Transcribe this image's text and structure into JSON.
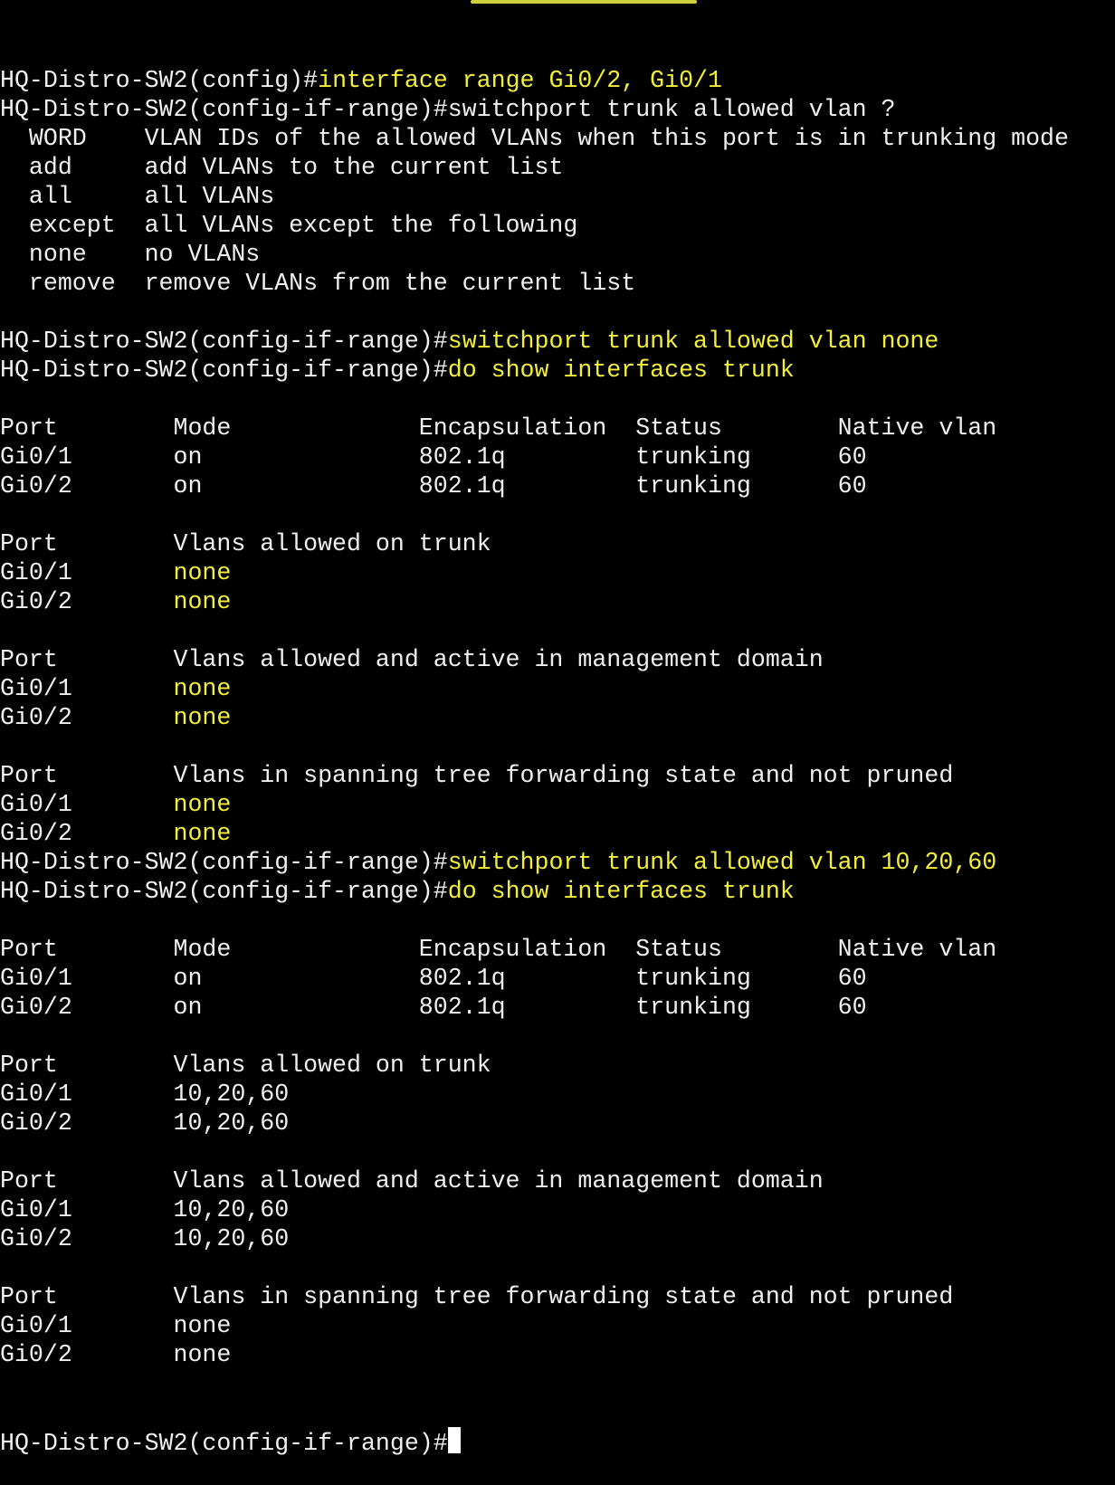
{
  "window": {
    "colors": {
      "background": "#000000",
      "text": "#f0f0f0",
      "highlight": "#f2ee3a"
    }
  },
  "terminal": {
    "lines": [
      [
        {
          "t": "HQ-Distro-SW2(config)#",
          "c": "w"
        },
        {
          "t": "interface range Gi0/2, Gi0/1",
          "c": "y"
        }
      ],
      [
        {
          "t": "HQ-Distro-SW2(config-if-range)#switchport trunk allowed vlan ?",
          "c": "w"
        }
      ],
      [
        {
          "t": "  WORD    VLAN IDs of the allowed VLANs when this port is in trunking mode",
          "c": "w"
        }
      ],
      [
        {
          "t": "  add     add VLANs to the current list",
          "c": "w"
        }
      ],
      [
        {
          "t": "  all     all VLANs",
          "c": "w"
        }
      ],
      [
        {
          "t": "  except  all VLANs except the following",
          "c": "w"
        }
      ],
      [
        {
          "t": "  none    no VLANs",
          "c": "w"
        }
      ],
      [
        {
          "t": "  remove  remove VLANs from the current list",
          "c": "w"
        }
      ],
      [
        {
          "t": "",
          "c": "w"
        }
      ],
      [
        {
          "t": "HQ-Distro-SW2(config-if-range)#",
          "c": "w"
        },
        {
          "t": "switchport trunk allowed vlan none",
          "c": "y"
        }
      ],
      [
        {
          "t": "HQ-Distro-SW2(config-if-range)#",
          "c": "w"
        },
        {
          "t": "do show interfaces trunk",
          "c": "y"
        }
      ],
      [
        {
          "t": "",
          "c": "w"
        }
      ],
      [
        {
          "t": "Port        Mode             Encapsulation  Status        Native vlan",
          "c": "w"
        }
      ],
      [
        {
          "t": "Gi0/1       on               802.1q         trunking      60",
          "c": "w"
        }
      ],
      [
        {
          "t": "Gi0/2       on               802.1q         trunking      60",
          "c": "w"
        }
      ],
      [
        {
          "t": "",
          "c": "w"
        }
      ],
      [
        {
          "t": "Port        Vlans allowed on trunk",
          "c": "w"
        }
      ],
      [
        {
          "t": "Gi0/1       ",
          "c": "w"
        },
        {
          "t": "none",
          "c": "y"
        }
      ],
      [
        {
          "t": "Gi0/2       ",
          "c": "w"
        },
        {
          "t": "none",
          "c": "y"
        }
      ],
      [
        {
          "t": "",
          "c": "w"
        }
      ],
      [
        {
          "t": "Port        Vlans allowed and active in management domain",
          "c": "w"
        }
      ],
      [
        {
          "t": "Gi0/1       ",
          "c": "w"
        },
        {
          "t": "none",
          "c": "y"
        }
      ],
      [
        {
          "t": "Gi0/2       ",
          "c": "w"
        },
        {
          "t": "none",
          "c": "y"
        }
      ],
      [
        {
          "t": "",
          "c": "w"
        }
      ],
      [
        {
          "t": "Port        Vlans in spanning tree forwarding state and not pruned",
          "c": "w"
        }
      ],
      [
        {
          "t": "Gi0/1       ",
          "c": "w"
        },
        {
          "t": "none",
          "c": "y"
        }
      ],
      [
        {
          "t": "Gi0/2       ",
          "c": "w"
        },
        {
          "t": "none",
          "c": "y"
        }
      ],
      [
        {
          "t": "HQ-Distro-SW2(config-if-range)#",
          "c": "w"
        },
        {
          "t": "switchport trunk allowed vlan 10,20,60",
          "c": "y"
        }
      ],
      [
        {
          "t": "HQ-Distro-SW2(config-if-range)#",
          "c": "w"
        },
        {
          "t": "do show interfaces trunk",
          "c": "y"
        }
      ],
      [
        {
          "t": "",
          "c": "w"
        }
      ],
      [
        {
          "t": "Port        Mode             Encapsulation  Status        Native vlan",
          "c": "w"
        }
      ],
      [
        {
          "t": "Gi0/1       on               802.1q         trunking      60",
          "c": "w"
        }
      ],
      [
        {
          "t": "Gi0/2       on               802.1q         trunking      60",
          "c": "w"
        }
      ],
      [
        {
          "t": "",
          "c": "w"
        }
      ],
      [
        {
          "t": "Port        Vlans allowed on trunk",
          "c": "w"
        }
      ],
      [
        {
          "t": "Gi0/1       10,20,60",
          "c": "w"
        }
      ],
      [
        {
          "t": "Gi0/2       10,20,60",
          "c": "w"
        }
      ],
      [
        {
          "t": "",
          "c": "w"
        }
      ],
      [
        {
          "t": "Port        Vlans allowed and active in management domain",
          "c": "w"
        }
      ],
      [
        {
          "t": "Gi0/1       10,20,60",
          "c": "w"
        }
      ],
      [
        {
          "t": "Gi0/2       10,20,60",
          "c": "w"
        }
      ],
      [
        {
          "t": "",
          "c": "w"
        }
      ],
      [
        {
          "t": "Port        Vlans in spanning tree forwarding state and not pruned",
          "c": "w"
        }
      ],
      [
        {
          "t": "Gi0/1       none",
          "c": "w"
        }
      ],
      [
        {
          "t": "Gi0/2       none",
          "c": "w"
        }
      ]
    ],
    "prompt": "HQ-Distro-SW2(config-if-range)#"
  }
}
